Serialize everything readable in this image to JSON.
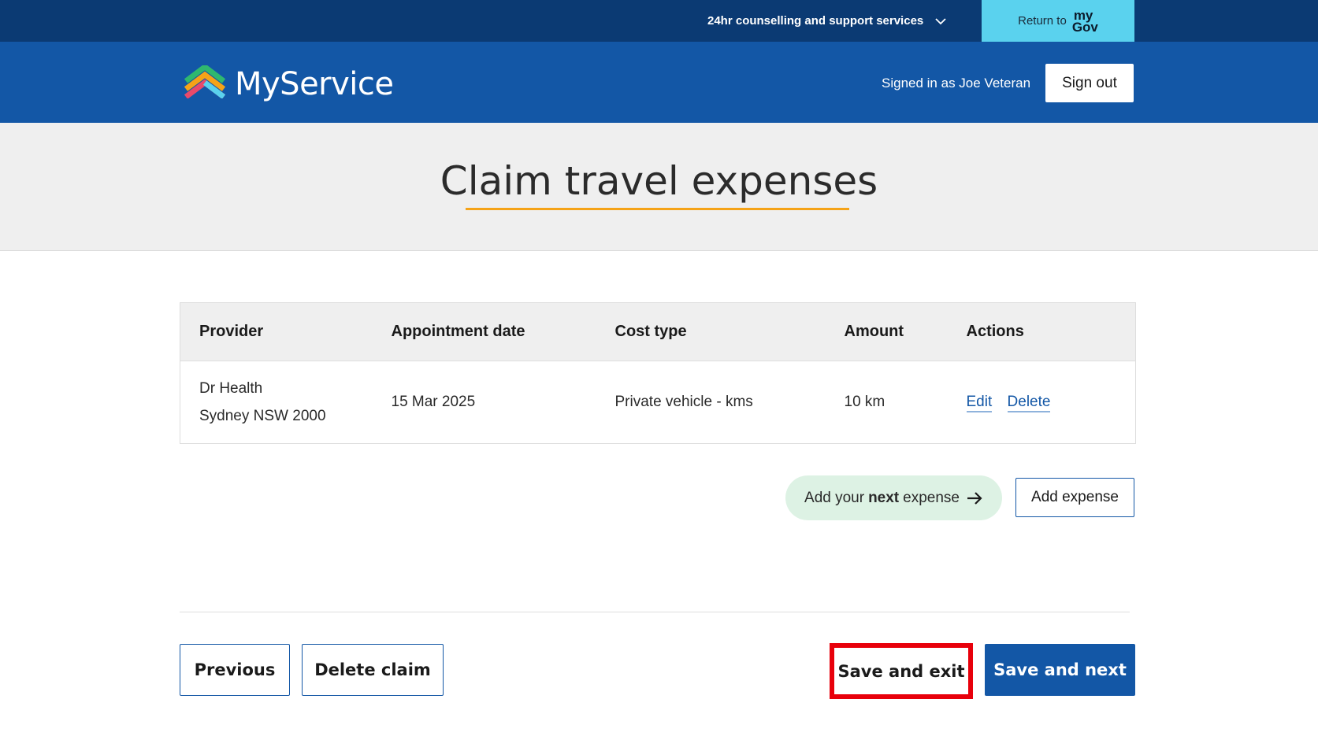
{
  "topbar": {
    "support_label": "24hr counselling and support services",
    "support_icon": "chevron-down-icon",
    "return_label": "Return to",
    "mygov_line1": "my",
    "mygov_line2": "Gov",
    "background_color": "#0b3a73",
    "mygov_color": "#5ad2ee"
  },
  "header": {
    "logo_text": "MyService",
    "signed_in_text": "Signed in as Joe Veteran",
    "signout_label": "Sign out",
    "background_color": "#1357a6"
  },
  "page": {
    "title": "Claim travel expenses",
    "accent_color": "#f5a318"
  },
  "table": {
    "headers": [
      "Provider",
      "Appointment date",
      "Cost type",
      "Amount",
      "Actions"
    ],
    "rows": [
      {
        "provider_name": "Dr Health",
        "provider_location": "Sydney NSW 2000",
        "appointment_date": "15 Mar 2025",
        "cost_type": "Private vehicle - kms",
        "amount": "10 km",
        "edit_label": "Edit",
        "delete_label": "Delete"
      }
    ]
  },
  "add_expense": {
    "hint_prefix": "Add your",
    "hint_bold": "next",
    "hint_suffix": "expense",
    "hint_icon": "arrow-right-icon",
    "button_label": "Add expense"
  },
  "footer_buttons": {
    "previous_label": "Previous",
    "delete_claim_label": "Delete claim",
    "save_exit_label": "Save and exit",
    "save_next_label": "Save and next",
    "highlight_color": "#e8000b"
  }
}
